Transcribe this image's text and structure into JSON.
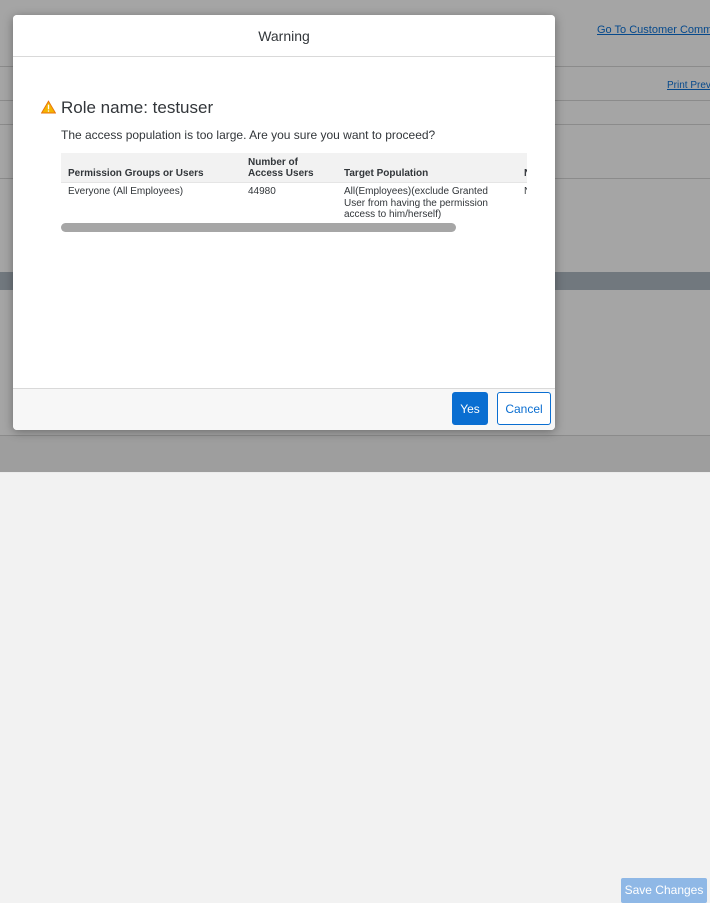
{
  "background": {
    "community_link": "Go To Customer Commun",
    "print_link": "Print Previ",
    "save_button": "Save Changes"
  },
  "dialog": {
    "title": "Warning",
    "heading": "Role name: testuser",
    "message": "The access population is too large. Are you sure you want to proceed?",
    "table": {
      "headers": [
        "Permission Groups or Users",
        "Number of Access Users",
        "Target Population",
        "N U"
      ],
      "rows": [
        [
          "Everyone (All Employees)",
          "44980",
          "All(Employees)(exclude Granted User from having the permission access to him/herself)",
          "N"
        ]
      ]
    },
    "buttons": {
      "yes": "Yes",
      "cancel": "Cancel"
    }
  },
  "icons": {
    "warning": "warning-triangle-icon"
  },
  "colors": {
    "accent": "#0a6ed1",
    "warning": "#e9730c"
  }
}
